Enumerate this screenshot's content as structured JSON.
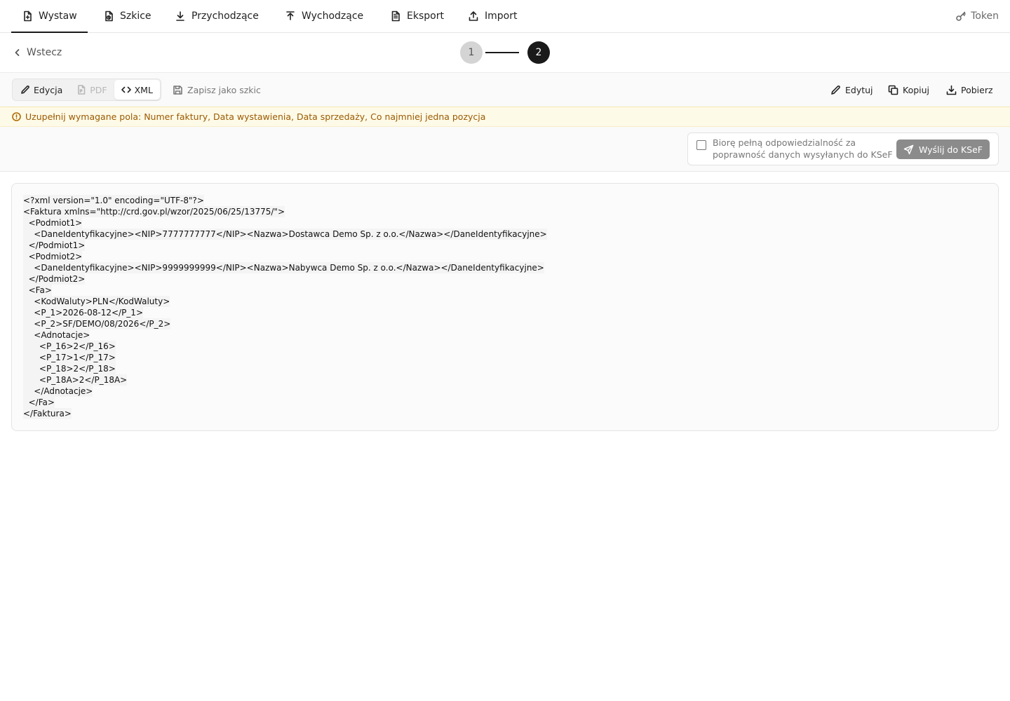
{
  "nav": {
    "items": [
      {
        "label": "Wystaw",
        "icon": "file-plus-icon",
        "active": true
      },
      {
        "label": "Szkice",
        "icon": "draft-file-icon",
        "active": false
      },
      {
        "label": "Przychodzące",
        "icon": "download-icon",
        "active": false
      },
      {
        "label": "Wychodzące",
        "icon": "upload-icon",
        "active": false
      },
      {
        "label": "Eksport",
        "icon": "file-text-icon",
        "active": false
      },
      {
        "label": "Import",
        "icon": "import-icon",
        "active": false
      }
    ],
    "token_label": "Token"
  },
  "stepper": {
    "back_label": "Wstecz",
    "step1": "1",
    "step2": "2",
    "current": 2
  },
  "toolbar": {
    "view_modes": [
      {
        "label": "Edycja",
        "icon": "pencil-icon",
        "state": "normal"
      },
      {
        "label": "PDF",
        "icon": "pdf-file-icon",
        "state": "disabled"
      },
      {
        "label": "XML",
        "icon": "code-icon",
        "state": "active"
      }
    ],
    "save_draft_label": "Zapisz jako szkic",
    "edit_label": "Edytuj",
    "copy_label": "Kopiuj",
    "download_label": "Pobierz"
  },
  "warning": {
    "text": "Uzupełnij wymagane pola: Numer faktury, Data wystawienia, Data sprzedaży, Co najmniej jedna pozycja",
    "color": "#9a5a00"
  },
  "send": {
    "responsibility_text": "Biorę pełną odpowiedzialność za poprawność danych wysyłanych do KSeF",
    "checked": false,
    "send_label": "Wyślij do KSeF"
  },
  "xml": {
    "lines": [
      "<?xml version=\"1.0\" encoding=\"UTF-8\"?>",
      "<Faktura xmlns=\"http://crd.gov.pl/wzor/2025/06/25/13775/\">",
      "  <Podmiot1>",
      "    <DaneIdentyfikacyjne><NIP>7777777777</NIP><Nazwa>Dostawca Demo Sp. z o.o.</Nazwa></DaneIdentyfikacyjne>",
      "  </Podmiot1>",
      "  <Podmiot2>",
      "    <DaneIdentyfikacyjne><NIP>9999999999</NIP><Nazwa>Nabywca Demo Sp. z o.o.</Nazwa></DaneIdentyfikacyjne>",
      "  </Podmiot2>",
      "  <Fa>",
      "    <KodWaluty>PLN</KodWaluty>",
      "    <P_1>2026-08-12</P_1>",
      "    <P_2>SF/DEMO/08/2026</P_2>",
      "    <Adnotacje>",
      "      <P_16>2</P_16>",
      "      <P_17>1</P_17>",
      "      <P_18>2</P_18>",
      "      <P_18A>2</P_18A>",
      "    </Adnotacje>",
      "  </Fa>",
      "</Faktura>"
    ]
  }
}
